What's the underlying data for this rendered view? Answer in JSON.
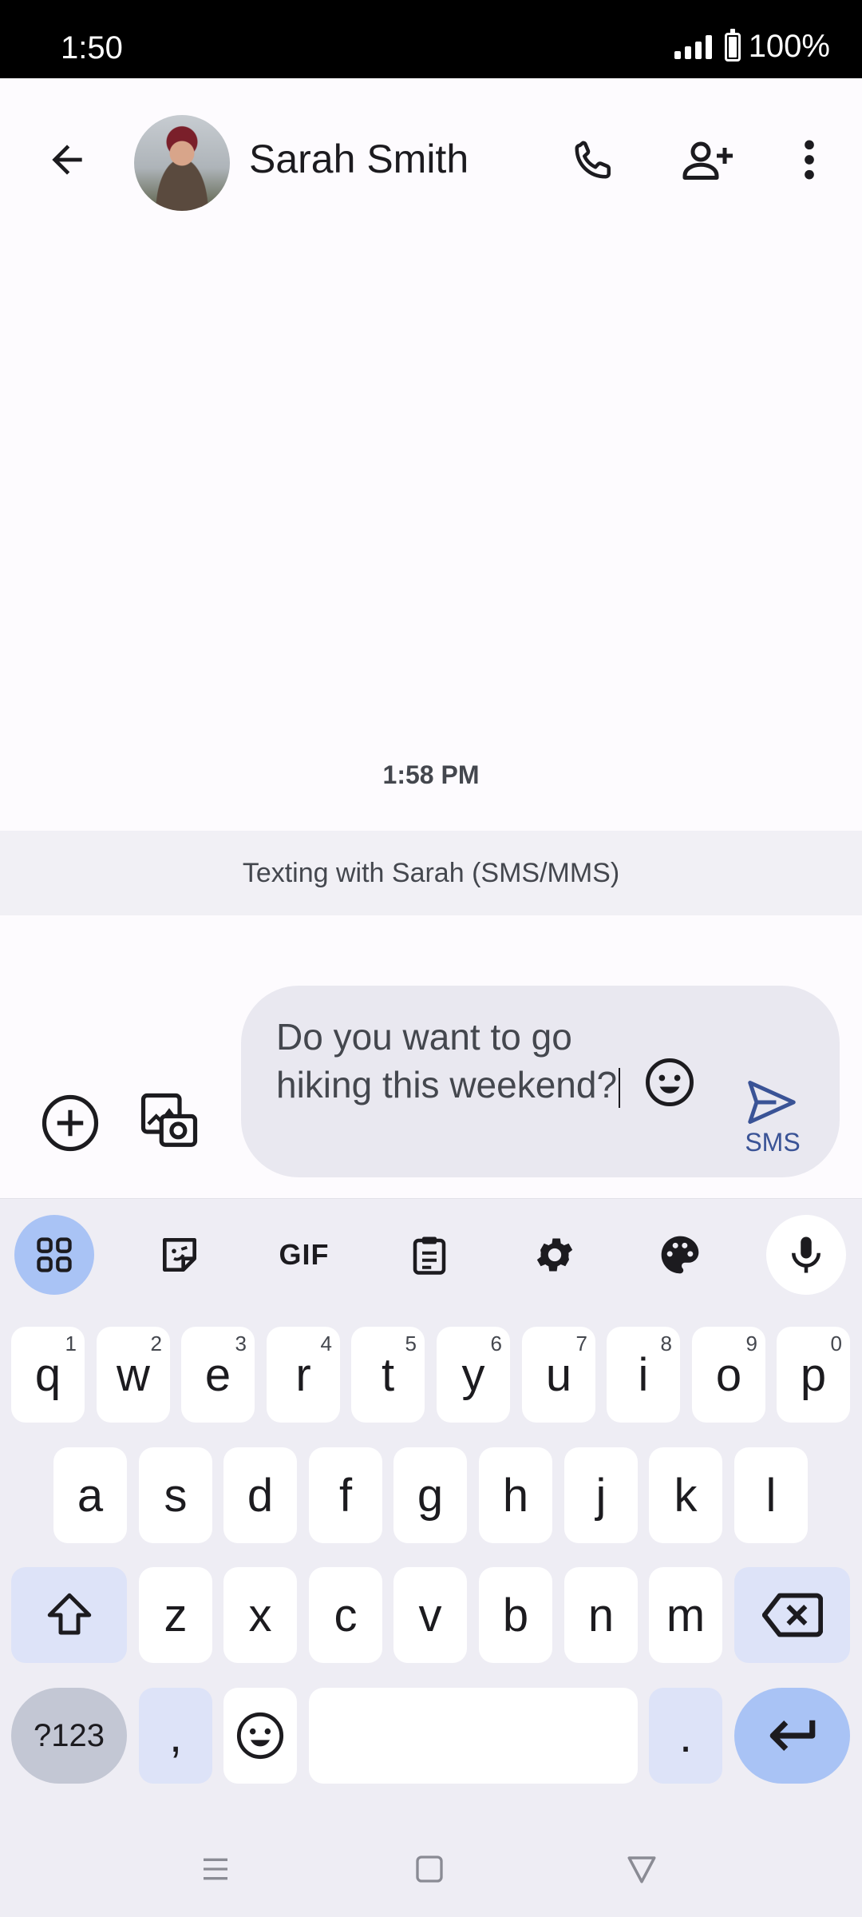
{
  "status_bar": {
    "time": "1:50",
    "battery": "100%"
  },
  "header": {
    "contact_name": "Sarah Smith"
  },
  "conversation": {
    "timestamp": "1:58 PM",
    "info": "Texting with Sarah (SMS/MMS)"
  },
  "compose": {
    "text": "Do you want to go hiking this weekend?",
    "send_label": "SMS"
  },
  "keyboard": {
    "toolbar": [
      "apps-icon",
      "sticker-icon",
      "gif-icon",
      "clipboard-icon",
      "settings-icon",
      "palette-icon",
      "mic-icon"
    ],
    "gif_label": "GIF",
    "row1": [
      {
        "k": "q",
        "h": "1"
      },
      {
        "k": "w",
        "h": "2"
      },
      {
        "k": "e",
        "h": "3"
      },
      {
        "k": "r",
        "h": "4"
      },
      {
        "k": "t",
        "h": "5"
      },
      {
        "k": "y",
        "h": "6"
      },
      {
        "k": "u",
        "h": "7"
      },
      {
        "k": "i",
        "h": "8"
      },
      {
        "k": "o",
        "h": "9"
      },
      {
        "k": "p",
        "h": "0"
      }
    ],
    "row2": [
      "a",
      "s",
      "d",
      "f",
      "g",
      "h",
      "j",
      "k",
      "l"
    ],
    "row3": [
      "z",
      "x",
      "c",
      "v",
      "b",
      "n",
      "m"
    ],
    "symbols_label": "?123",
    "comma": ",",
    "period": "."
  },
  "colors": {
    "accent": "#a9c3f5",
    "send": "#3a5396",
    "surface": "#fdfbfe"
  }
}
